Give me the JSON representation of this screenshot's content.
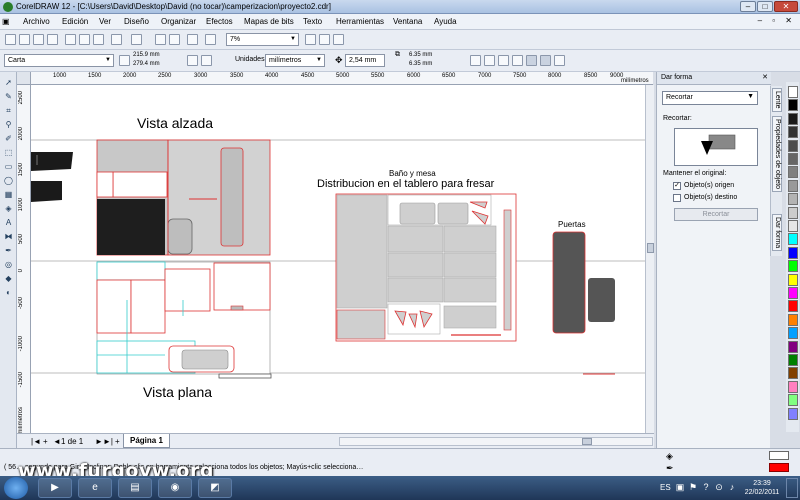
{
  "window": {
    "title": "CorelDRAW 12 - [C:\\Users\\David\\Desktop\\David (no tocar)\\camperizacion\\proyecto2.cdr]",
    "controls": [
      "–",
      "□",
      "✕"
    ]
  },
  "menubar": {
    "items": [
      "Archivo",
      "Edición",
      "Ver",
      "Diseño",
      "Organizar",
      "Efectos",
      "Mapas de bits",
      "Texto",
      "Herramientas",
      "Ventana",
      "Ayuda"
    ],
    "doc_controls": "– ▫ ✕"
  },
  "toolbar1": {
    "zoom_value": "7%"
  },
  "toolbar2": {
    "paper_type": "Carta",
    "width": "215.9 mm",
    "height": "279.4 mm",
    "units_label": "Unidades:",
    "units_value": "milímetros",
    "nudge": "2,54 mm",
    "dup_x": "6.35 mm",
    "dup_y": "6.35 mm"
  },
  "ruler": {
    "h_ticks": [
      "1000",
      "1500",
      "2000",
      "2500",
      "3000",
      "3500",
      "4000",
      "4500",
      "5000",
      "5500",
      "6000",
      "6500",
      "7000",
      "7500",
      "8000",
      "8500",
      "9000"
    ],
    "h_unit": "milímetros",
    "v_ticks": [
      "2500",
      "2000",
      "1500",
      "1000",
      "500",
      "0",
      "-500",
      "-1000",
      "-1500"
    ],
    "v_unit": "milímetros"
  },
  "canvas": {
    "label_vista_alzada": "Vista alzada",
    "label_vista_plana": "Vista plana",
    "label_bano": "Baño y mesa",
    "label_distribucion": "Distribucion en el tablero para fresar",
    "label_puertas": "Puertas"
  },
  "pagebar": {
    "page_count": "1 de 1",
    "page_tab": "Página 1",
    "nav_first": "|◄",
    "nav_prev": "◄",
    "nav_next": "►",
    "nav_last": "►|",
    "add_page": "+"
  },
  "docker": {
    "header": "Dar forma",
    "mode": "Recortar",
    "section_label": "Recortar:",
    "keep_original": "Mantener el original:",
    "opt_source": "Objeto(s) origen",
    "opt_target": "Objeto(s) destino",
    "opt_source_checked": true,
    "opt_target_checked": false,
    "apply_button": "Recortar",
    "tabs": [
      "Lente",
      "Propiedades de objeto",
      "Dar forma"
    ]
  },
  "palette": {
    "colors": [
      "#ffffff",
      "#000000",
      "#1a1a1a",
      "#333333",
      "#4d4d4d",
      "#666666",
      "#808080",
      "#999999",
      "#b3b3b3",
      "#cccccc",
      "#e6e6e6",
      "#00ffff",
      "#0000ff",
      "#00ff00",
      "#ffff00",
      "#ff00ff",
      "#ff0000",
      "#ff8000",
      "#00a0ff",
      "#800080",
      "#008000",
      "#804000",
      "#ff80c0",
      "#80ff80",
      "#8080ff"
    ]
  },
  "status": {
    "text": "( 56… segundo para Girar/Inclinar; Doble clic en herramienta selecciona todos los objetos; Mayús+clic selecciona…",
    "watermark": "www.furgovw.org"
  },
  "taskbar": {
    "language": "ES",
    "time": "23:39",
    "date": "22/02/2011"
  }
}
